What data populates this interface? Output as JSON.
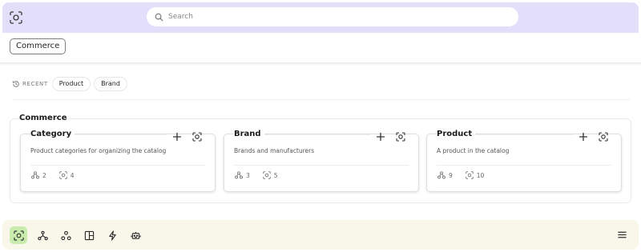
{
  "header": {
    "logo_icon": "scan-icon",
    "search": {
      "placeholder": "Search",
      "value": ""
    },
    "active_model": "Commerce"
  },
  "recent": {
    "label": "RECENT",
    "icon": "history-icon",
    "items": [
      "Product",
      "Brand"
    ]
  },
  "group": {
    "title": "Commerce",
    "cards": [
      {
        "title": "Category",
        "description": "Product categories for organizing the catalog",
        "relations": "2",
        "fields": "4"
      },
      {
        "title": "Brand",
        "description": "Brands and manufacturers",
        "relations": "3",
        "fields": "5"
      },
      {
        "title": "Product",
        "description": "A product in the catalog",
        "relations": "9",
        "fields": "10"
      }
    ]
  },
  "bottom_nav": {
    "items": [
      "scan-icon",
      "graph-icon",
      "nodes-icon",
      "layout-icon",
      "bolt-icon",
      "robot-icon"
    ],
    "active": "scan-icon",
    "menu_icon": "hamburger-icon"
  },
  "colors": {
    "header_band": "#e3defa",
    "bottom_bar": "#f8f7ea",
    "active_nav": "#c9ecae"
  }
}
